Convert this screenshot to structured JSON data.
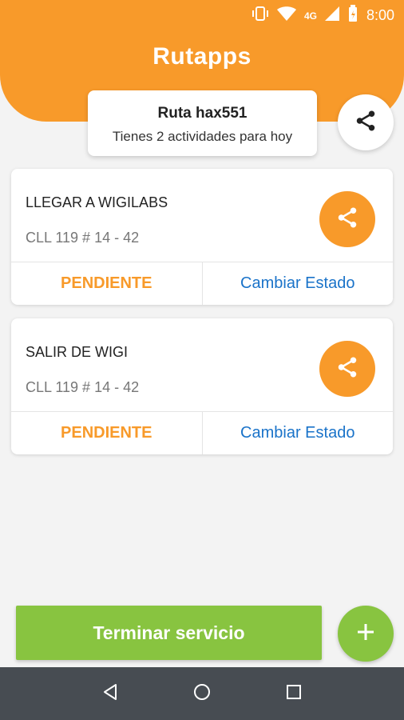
{
  "status_bar": {
    "network": "4G",
    "time": "8:00"
  },
  "header": {
    "logo": "Rutapps"
  },
  "route": {
    "title": "Ruta hax551",
    "subtitle": "Tienes 2 actividades para hoy"
  },
  "activities": [
    {
      "name": "LLEGAR A WIGILABS",
      "address": "CLL 119 # 14 - 42",
      "status": "PENDIENTE",
      "action": "Cambiar Estado"
    },
    {
      "name": "SALIR DE WIGI",
      "address": "CLL 119 # 14 - 42",
      "status": "PENDIENTE",
      "action": "Cambiar Estado"
    }
  ],
  "footer": {
    "finish_label": "Terminar servicio"
  },
  "colors": {
    "brand_orange": "#f89a2a",
    "green": "#88c440",
    "link_blue": "#1a73c9",
    "navbar": "#474c52"
  }
}
